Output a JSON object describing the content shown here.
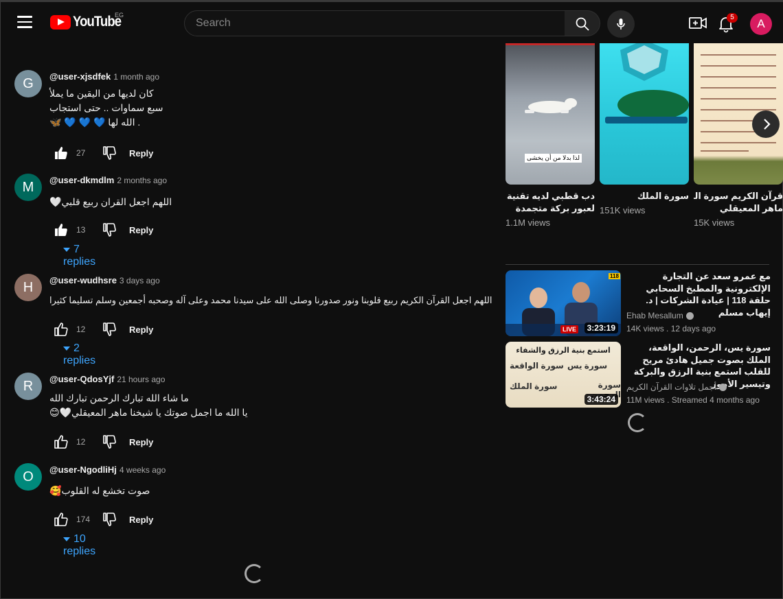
{
  "header": {
    "logo_text": "YouTube",
    "country_code": "EG",
    "search_placeholder": "Search",
    "notification_count": "5",
    "avatar_letter": "A"
  },
  "comments": [
    {
      "avatar_letter": "G",
      "avatar_color": "#78909c",
      "author": "@user-xjsdfek",
      "time": "1 month ago",
      "lines": [
        "كان لديها من اليقين ما يملأ",
        "سبع سماوات .. حتى استجاب",
        "🦋 💙 💙 💙 الله لها ."
      ],
      "likes": "27",
      "reply_label": "Reply"
    },
    {
      "avatar_letter": "M",
      "avatar_color": "#00695c",
      "author": "@user-dkmdlm",
      "time": "2 months ago",
      "lines": [
        "🤍اللهم اجعل القران ربيع قلبي"
      ],
      "likes": "13",
      "reply_label": "Reply",
      "replies": "7 replies"
    },
    {
      "avatar_letter": "H",
      "avatar_color": "#8d6e63",
      "author": "@user-wudhsre",
      "time": "3 days ago",
      "lines": [
        "اللهم اجعل القرآن الكريم ربيع قلوبنا ونور صدورنا وصلى الله على سيدنا محمد وعلى آله وصحبه أجمعين وسلم تسليما كثيرا"
      ],
      "likes": "12",
      "reply_label": "Reply",
      "replies": "2 replies"
    },
    {
      "avatar_letter": "R",
      "avatar_color": "#78909c",
      "author": "@user-QdosYjf",
      "time": "21 hours ago",
      "lines": [
        "ما شاء الله تبارك الرحمن تبارك الله",
        "😊🤍يا الله ما اجمل صوتك يا شيخنا ماهر المعيقلي"
      ],
      "likes": "12",
      "reply_label": "Reply"
    },
    {
      "avatar_letter": "O",
      "avatar_color": "#00897b",
      "author": "@user-NgodliHj",
      "time": "4 weeks ago",
      "lines": [
        "🥰صوت تخشع له القلوب"
      ],
      "likes": "174",
      "reply_label": "Reply",
      "replies": "10 replies"
    }
  ],
  "shorts": [
    {
      "title_lines": [
        "دب قطبي لديه تقنية آمنة",
        "لعبور بركة متجمدة"
      ],
      "views": "1.1M views",
      "overlay_text": "لذا بدلا من أن يخشى"
    },
    {
      "title_lines": [
        "سورة الملك"
      ],
      "views": "151K views"
    },
    {
      "title_lines": [
        "قرآن الكريم سورة الزمر",
        "ماهر المعيقلي"
      ],
      "views": "15K views"
    }
  ],
  "videos": [
    {
      "title": "مع عمرو سعد عن التجارة الإلكترونية والمطبخ السحابي حلقة 118 | عيادة الشركات | د. إيهاب مسلم",
      "channel": "Ehab Mesallum",
      "meta": "14K views . 12 days ago",
      "duration": "3:23:19",
      "live_label": "LIVE",
      "episode": "118"
    },
    {
      "title": "سورة يس، الرحمن، الواقعة، الملك بصوت جميل هادئ مريح للقلب استمع بنية الرزق والبركة وتيسير الأمور",
      "channel": "أجمل تلاوات القرآن الكريم",
      "meta": "11M views . Streamed 4 months ago",
      "duration": "3:43:24",
      "thumb_heading": "استمع بنية الرزق والشفاء",
      "thumb_surahs": [
        "سورة يس",
        "سورة الواقعة",
        "سورة الرحمن",
        "سورة الملك"
      ]
    }
  ]
}
